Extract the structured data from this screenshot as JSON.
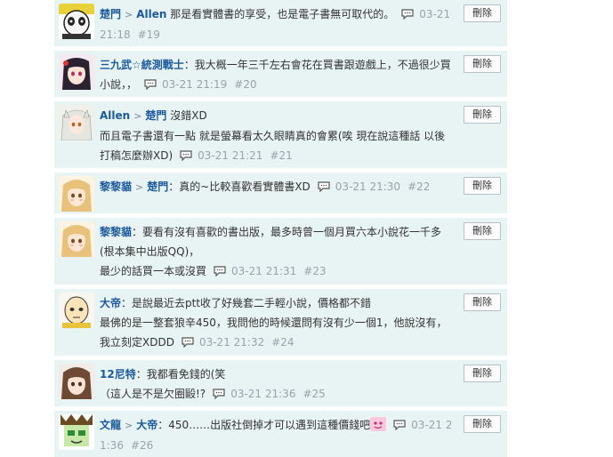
{
  "delete_label": "刪除",
  "comments": [
    {
      "author": "楚門",
      "reply_to": "Allen",
      "text": "那是看實體書的享受，也是電子書無可取代的。",
      "time": "03-21 21:18",
      "floor": "#19",
      "avatar": "panda-avatar"
    },
    {
      "author": "三九武☆統測戰士",
      "text": "我大概一年三千左右會花在買書跟遊戲上，不過很少買小說，，",
      "time": "03-21 21:19",
      "floor": "#20",
      "avatar": "anime-girl-avatar"
    },
    {
      "author": "Allen",
      "reply_to": "楚門",
      "text_line1": "沒錯XD",
      "text_line2": "而且電子書還有一點 就是螢幕看太久眼睛真的會累(唉 現在說這種話 以後打稿怎麼辦XD)",
      "time": "03-21 21:21",
      "floor": "#21",
      "avatar": "white-hair-avatar"
    },
    {
      "author": "黎黎貓",
      "reply_to": "楚門",
      "text": "真的~比較喜歡看實體書XD",
      "time": "03-21 21:30",
      "floor": "#22",
      "avatar": "blonde-girl-avatar"
    },
    {
      "author": "黎黎貓",
      "text_line1": "要看有沒有喜歡的書出版，最多時曾一個月買六本小說花一千多(根本集中出版QQ)，",
      "text_line2": "最少的話買一本或沒買",
      "time": "03-21 21:31",
      "floor": "#23",
      "avatar": "blonde-girl-avatar"
    },
    {
      "author": "大帝",
      "text_line1": "是說最近去ptt收了好幾套二手輕小說，價格都不錯",
      "text_line2": "最佛的是一整套狼辛450，我問他的時候還問有沒有少一個1，他說沒有，我立刻定XDDD",
      "time": "03-21 21:32",
      "floor": "#24",
      "avatar": "bald-hero-avatar"
    },
    {
      "author": "12尼特",
      "text_line1": "我都看免錢的(笑",
      "text_line2": "（這人是不是欠圈毆!?",
      "time": "03-21 21:36",
      "floor": "#25",
      "avatar": "brown-hair-avatar"
    },
    {
      "author": "文龍",
      "reply_to": "大帝",
      "text": "450……出版社倒掉才可以遇到這種價錢吧",
      "time": "03-21 21:36",
      "floor": "#26",
      "avatar": "green-mask-avatar"
    }
  ]
}
